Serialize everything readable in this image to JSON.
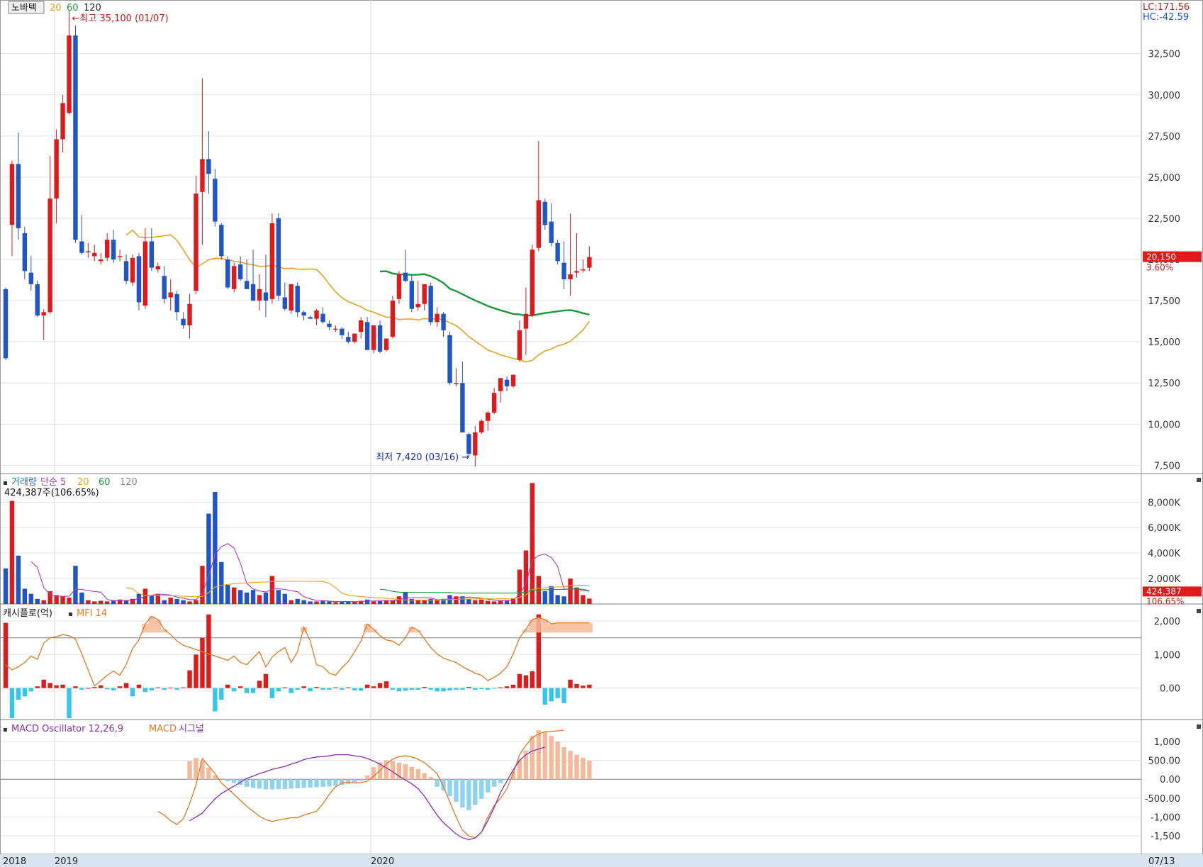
{
  "stock_name": "노바텍",
  "ma_labels": [
    {
      "text": "20",
      "color": "#e8a31f"
    },
    {
      "text": "60",
      "color": "#1a9a3a"
    },
    {
      "text": "120",
      "color": "#222222"
    }
  ],
  "lc_text": "LC:171.56",
  "hc_text": "HC:-42.59",
  "high_annotation": "최고 35,100 (01/07)",
  "low_annotation": "최저 7,420 (03/16)",
  "price_ticks": [
    "32,500",
    "30,000",
    "27,500",
    "25,000",
    "22,500",
    "20,000",
    "17,500",
    "15,000",
    "12,500",
    "10,000",
    "7,500"
  ],
  "current_price": "20,150",
  "current_change": "3.60%",
  "volume_labels": [
    {
      "text": "거래량",
      "color": "#1a6fc9"
    },
    {
      "text": "단순 5",
      "color": "#b23ab8"
    },
    {
      "text": "20",
      "color": "#e8a31f"
    },
    {
      "text": "60",
      "color": "#1a9a3a"
    },
    {
      "text": "120",
      "color": "#888888"
    }
  ],
  "volume_current_text": "424,387주(106.65%)",
  "volume_ticks": [
    "8,000K",
    "6,000K",
    "4,000K",
    "2,000K"
  ],
  "volume_current": "424,387",
  "volume_pct": "106.65%",
  "cashflow_label": "캐시플로(억)",
  "mfi_label": "MFI 14",
  "cashflow_ticks": [
    "2,000",
    "1,000",
    "0.00"
  ],
  "macd_labels": [
    {
      "text": "MACD Oscillator 12,26,9",
      "color": "#8a2fb0"
    },
    {
      "text": "MACD",
      "color": "#e07b22"
    },
    {
      "text": "시그널",
      "color": "#8a2fb0"
    }
  ],
  "macd_ticks": [
    "1,000",
    "500.00",
    "0.00",
    "-500.00",
    "-1,000",
    "-1,500"
  ],
  "x_axis_labels": [
    "2018",
    "2019",
    "2020"
  ],
  "x_axis_right": "07/13",
  "colors": {
    "up": "#e0191b",
    "down": "#1f55c8",
    "ma20": "#e8a31f",
    "ma60": "#1a9a3a",
    "mfi": "#e07b22",
    "cash_neg": "#34c6ee",
    "macd_pos": "#f5b99a",
    "macd_neg": "#8fd3f2",
    "signal": "#8a2fb0"
  },
  "chart_data": {
    "type": "candlestick",
    "period": "weekly",
    "price_axis": {
      "min": 7000,
      "max": 35500,
      "ticks": [
        7500,
        10000,
        12500,
        15000,
        17500,
        20000,
        22500,
        25000,
        27500,
        30000,
        32500
      ]
    },
    "candles": [
      [
        18200,
        18300,
        13900,
        14000
      ],
      [
        22100,
        26000,
        20200,
        25800
      ],
      [
        25800,
        27700,
        21200,
        21900
      ],
      [
        21600,
        22000,
        18800,
        19300
      ],
      [
        19200,
        20200,
        18100,
        18500
      ],
      [
        18500,
        18700,
        16500,
        16600
      ],
      [
        16600,
        17000,
        15100,
        16800
      ],
      [
        16800,
        26300,
        16700,
        23700
      ],
      [
        23700,
        27900,
        22200,
        27300
      ],
      [
        27300,
        30000,
        26500,
        29500
      ],
      [
        28900,
        35100,
        28800,
        33600
      ],
      [
        33600,
        34200,
        21000,
        21200
      ],
      [
        21100,
        22700,
        20300,
        20400
      ],
      [
        20500,
        21000,
        20100,
        20500
      ],
      [
        20200,
        20900,
        19900,
        20400
      ],
      [
        19900,
        20400,
        19700,
        20000
      ],
      [
        20100,
        21600,
        19900,
        21200
      ],
      [
        21200,
        21800,
        19800,
        20000
      ],
      [
        20200,
        20600,
        19900,
        20200
      ],
      [
        19900,
        20300,
        18500,
        18700
      ],
      [
        18600,
        20300,
        18400,
        20100
      ],
      [
        20200,
        20400,
        16900,
        17400
      ],
      [
        17200,
        21900,
        17000,
        21100
      ],
      [
        21100,
        21900,
        19300,
        19500
      ],
      [
        19400,
        19800,
        19200,
        19600
      ],
      [
        19000,
        19600,
        17300,
        17600
      ],
      [
        17700,
        18800,
        16900,
        18000
      ],
      [
        17900,
        18100,
        16300,
        16800
      ],
      [
        16400,
        16800,
        15800,
        16000
      ],
      [
        16000,
        17900,
        15200,
        17300
      ],
      [
        18100,
        25100,
        17900,
        24000
      ],
      [
        24100,
        31000,
        20900,
        26100
      ],
      [
        26100,
        27800,
        24000,
        25200
      ],
      [
        24900,
        25500,
        22000,
        22300
      ],
      [
        22100,
        22200,
        20000,
        20200
      ],
      [
        20000,
        20200,
        18200,
        18300
      ],
      [
        18200,
        19800,
        18000,
        19600
      ],
      [
        19700,
        20200,
        18700,
        18800
      ],
      [
        18700,
        20000,
        18300,
        18200
      ],
      [
        18500,
        20600,
        17800,
        17500
      ],
      [
        17500,
        19100,
        16900,
        18200
      ],
      [
        18000,
        20300,
        16500,
        17500
      ],
      [
        17600,
        22800,
        17300,
        22200
      ],
      [
        22500,
        22800,
        17500,
        17800
      ],
      [
        17700,
        18600,
        16900,
        17000
      ],
      [
        16900,
        18500,
        16700,
        18500
      ],
      [
        18400,
        18600,
        16500,
        16800
      ],
      [
        16800,
        16900,
        16300,
        16600
      ],
      [
        16500,
        16600,
        16400,
        16400
      ],
      [
        16400,
        17000,
        16000,
        16900
      ],
      [
        16700,
        17100,
        16100,
        16200
      ],
      [
        16100,
        16300,
        15700,
        15900
      ],
      [
        15800,
        16000,
        15600,
        15800
      ],
      [
        15800,
        15900,
        15200,
        15400
      ],
      [
        15300,
        15600,
        14900,
        15000
      ],
      [
        15000,
        15500,
        14900,
        15500
      ],
      [
        15600,
        16500,
        15200,
        16300
      ],
      [
        16200,
        16500,
        14500,
        14500
      ],
      [
        14500,
        16000,
        14300,
        16000
      ],
      [
        16000,
        16300,
        14300,
        14400
      ],
      [
        14500,
        15200,
        14400,
        15200
      ],
      [
        15300,
        17800,
        15200,
        17500
      ],
      [
        17600,
        19300,
        17300,
        19100
      ],
      [
        19200,
        20600,
        18600,
        18700
      ],
      [
        18700,
        19100,
        16800,
        17000
      ],
      [
        17100,
        18700,
        16900,
        17300
      ],
      [
        17300,
        18500,
        16900,
        18500
      ],
      [
        18400,
        18600,
        16000,
        16200
      ],
      [
        16200,
        17100,
        15900,
        16700
      ],
      [
        16700,
        16800,
        15300,
        15700
      ],
      [
        15400,
        15600,
        12400,
        12500
      ],
      [
        12500,
        13400,
        12300,
        12500
      ],
      [
        12500,
        13800,
        9500,
        9500
      ],
      [
        9400,
        9500,
        8000,
        8200
      ],
      [
        8100,
        9900,
        7420,
        9500
      ],
      [
        9500,
        10300,
        9400,
        10200
      ],
      [
        10200,
        10800,
        9600,
        10700
      ],
      [
        10700,
        12200,
        10600,
        11900
      ],
      [
        12000,
        12600,
        11300,
        12800
      ],
      [
        12700,
        12900,
        12000,
        12300
      ],
      [
        12300,
        13000,
        12200,
        13000
      ],
      [
        13900,
        16300,
        13800,
        15700
      ],
      [
        15800,
        18300,
        14200,
        16700
      ],
      [
        16600,
        20900,
        16500,
        20600
      ],
      [
        20700,
        27200,
        20500,
        23600
      ],
      [
        23500,
        23700,
        21800,
        22100
      ],
      [
        22300,
        23400,
        20800,
        21000
      ],
      [
        21000,
        21200,
        19700,
        19900
      ],
      [
        19800,
        21100,
        18200,
        18800
      ],
      [
        18800,
        22800,
        17800,
        19100
      ],
      [
        19200,
        21600,
        18900,
        19300
      ],
      [
        19400,
        20000,
        19200,
        19400
      ],
      [
        19500,
        20800,
        19300,
        20150
      ]
    ],
    "volume": [
      2800,
      8100,
      3800,
      1200,
      800,
      400,
      300,
      1000,
      700,
      600,
      500,
      3000,
      900,
      300,
      200,
      250,
      200,
      300,
      350,
      300,
      400,
      800,
      1200,
      700,
      800,
      300,
      500,
      400,
      300,
      200,
      300,
      3000,
      7100,
      8800,
      3300,
      1500,
      1300,
      1100,
      900,
      1100,
      700,
      900,
      2200,
      1100,
      800,
      300,
      400,
      300,
      200,
      200,
      250,
      200,
      150,
      200,
      180,
      180,
      250,
      350,
      200,
      250,
      300,
      300,
      600,
      900,
      400,
      300,
      300,
      400,
      300,
      400,
      700,
      600,
      600,
      400,
      300,
      350,
      250,
      200,
      250,
      300,
      450,
      2700,
      4200,
      9500,
      2200,
      1000,
      1400,
      700,
      600,
      2000,
      1300,
      700,
      424
    ],
    "volume_axis": {
      "min": 0,
      "max": 9800,
      "ticks": [
        2000,
        4000,
        6000,
        8000
      ]
    },
    "cashflow": [
      1950,
      -900,
      -350,
      -250,
      -100,
      50,
      250,
      150,
      80,
      100,
      -900,
      50,
      -50,
      0,
      30,
      80,
      -40,
      -70,
      50,
      150,
      -250,
      100,
      -120,
      -70,
      20,
      -50,
      10,
      -50,
      20,
      530,
      1000,
      1500,
      2200,
      -700,
      -350,
      100,
      -100,
      50,
      -150,
      -150,
      220,
      420,
      -300,
      -100,
      20,
      -150,
      -50,
      50,
      -100,
      30,
      -50,
      -50,
      20,
      -50,
      20,
      -70,
      -80,
      100,
      50,
      150,
      200,
      -50,
      -100,
      -80,
      -50,
      -50,
      30,
      -50,
      -100,
      -100,
      -70,
      -50,
      -50,
      30,
      -50,
      -30,
      -50,
      -20,
      20,
      50,
      100,
      420,
      380,
      500,
      2200,
      -500,
      -400,
      -300,
      -450,
      250,
      120,
      70,
      100
    ],
    "cashflow_axis": {
      "min": -900,
      "max": 2300,
      "ticks": [
        0,
        1000,
        2000
      ]
    },
    "mfi": [
      50,
      45,
      48,
      52,
      58,
      55,
      70,
      75,
      76,
      78,
      77,
      74,
      60,
      45,
      30,
      35,
      40,
      44,
      40,
      50,
      65,
      73,
      88,
      95,
      92,
      83,
      78,
      72,
      68,
      66,
      64,
      62,
      60,
      58,
      56,
      54,
      58,
      52,
      50,
      56,
      62,
      48,
      57,
      62,
      66,
      52,
      62,
      85,
      72,
      50,
      48,
      42,
      40,
      47,
      53,
      62,
      72,
      88,
      83,
      77,
      73,
      72,
      68,
      75,
      85,
      82,
      74,
      66,
      60,
      56,
      54,
      52,
      48,
      45,
      42,
      40,
      35,
      38,
      42,
      48,
      60,
      75,
      83,
      92,
      94,
      92,
      88,
      89,
      89,
      89,
      89,
      89,
      89
    ],
    "macd_oscillator": [
      null,
      null,
      null,
      null,
      null,
      null,
      null,
      null,
      null,
      null,
      null,
      null,
      null,
      null,
      null,
      null,
      null,
      null,
      null,
      null,
      null,
      null,
      null,
      null,
      null,
      null,
      null,
      null,
      null,
      480,
      560,
      480,
      300,
      100,
      20,
      -50,
      -100,
      -150,
      -200,
      -230,
      -250,
      -270,
      -270,
      -260,
      -260,
      -250,
      -240,
      -230,
      -220,
      -210,
      -200,
      -190,
      -170,
      -150,
      -120,
      -80,
      -40,
      100,
      320,
      450,
      500,
      480,
      440,
      400,
      330,
      270,
      160,
      60,
      -200,
      -300,
      -450,
      -600,
      -750,
      -820,
      -680,
      -520,
      -350,
      -200,
      -100,
      0,
      200,
      520,
      760,
      1150,
      1300,
      1250,
      1150,
      1000,
      850,
      750,
      650,
      570,
      490
    ],
    "macd": [
      null,
      null,
      null,
      null,
      null,
      null,
      null,
      null,
      null,
      null,
      null,
      null,
      null,
      null,
      null,
      null,
      null,
      null,
      null,
      null,
      null,
      null,
      null,
      null,
      -850,
      -950,
      -1100,
      -1200,
      -1050,
      -650,
      -150,
      550,
      350,
      150,
      -100,
      -250,
      -400,
      -560,
      -720,
      -850,
      -980,
      -1070,
      -1120,
      -1080,
      -1050,
      -1020,
      -1020,
      -950,
      -900,
      -850,
      -650,
      -400,
      -200,
      -100,
      -80,
      -100,
      -90,
      -50,
      80,
      230,
      400,
      530,
      600,
      620,
      590,
      530,
      440,
      300,
      150,
      -200,
      -600,
      -1000,
      -1350,
      -1500,
      -1550,
      -1400,
      -1000,
      -700,
      -500,
      -250,
      150,
      650,
      900,
      1100,
      1200,
      1260,
      1270,
      1280,
      1300
    ],
    "signal": [
      null,
      null,
      null,
      null,
      null,
      null,
      null,
      null,
      null,
      null,
      null,
      null,
      null,
      null,
      null,
      null,
      null,
      null,
      null,
      null,
      null,
      null,
      null,
      null,
      null,
      null,
      null,
      null,
      null,
      -1100,
      -1000,
      -900,
      -700,
      -520,
      -380,
      -280,
      -180,
      -80,
      20,
      80,
      150,
      200,
      260,
      300,
      340,
      400,
      450,
      520,
      560,
      590,
      600,
      620,
      650,
      650,
      650,
      620,
      600,
      550,
      480,
      400,
      300,
      200,
      80,
      -20,
      -120,
      -250,
      -450,
      -700,
      -950,
      -1150,
      -1300,
      -1450,
      -1550,
      -1600,
      -1560,
      -1400,
      -1100,
      -750,
      -350,
      -50,
      250,
      500,
      650,
      750,
      800,
      850
    ],
    "macd_axis": {
      "min": -1950,
      "max": 1450,
      "ticks": [
        -1500,
        -1000,
        -500,
        0,
        500,
        1000
      ]
    }
  }
}
